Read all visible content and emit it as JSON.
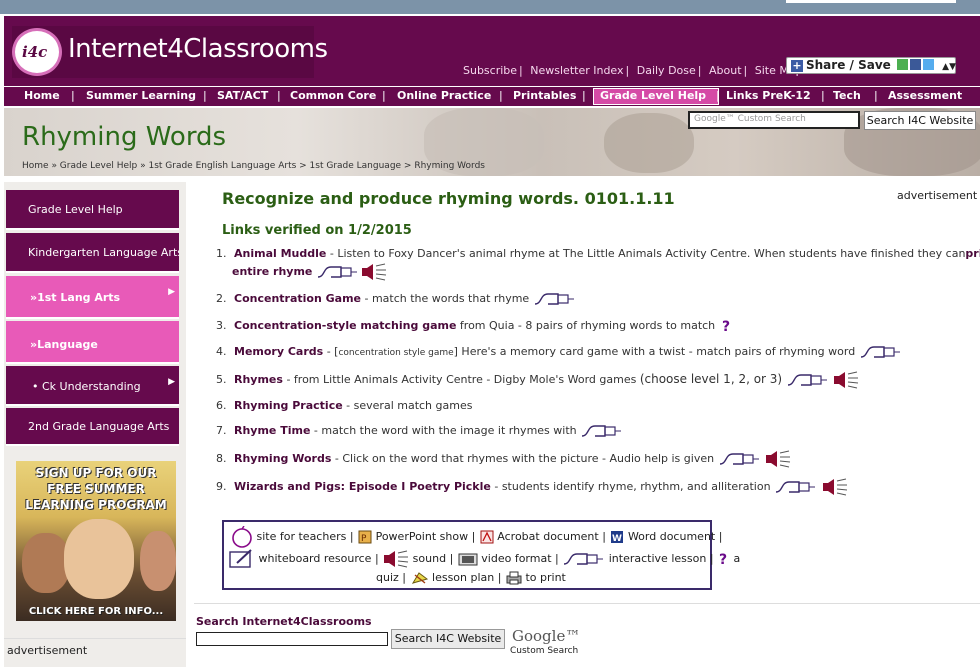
{
  "header": {
    "logo_badge": "i4c",
    "logo_text": "Internet4Classrooms",
    "top_links": [
      "Subscribe",
      "Newsletter Index",
      "Daily Dose",
      "About",
      "Site Map"
    ],
    "share_label": "Share / Save"
  },
  "nav": {
    "items": [
      "Home",
      "Summer Learning",
      "SAT/ACT",
      "Common Core",
      "Online Practice",
      "Printables",
      "Grade Level Help",
      "Links PreK-12",
      "Tech",
      "Assessment"
    ],
    "active": "Grade Level Help"
  },
  "banner": {
    "title": "Rhyming Words",
    "breadcrumb": "Home »  Grade Level Help  »  1st Grade English Language Arts >  1st Grade Language >  Rhyming Words",
    "search_placeholder": "Google™ Custom Search",
    "search_button": "Search I4C Website"
  },
  "sidebar": {
    "items": [
      {
        "label": "Grade Level Help",
        "style": "dark"
      },
      {
        "label": "Kindergarten Language Arts",
        "style": "dark"
      },
      {
        "label": "1st Lang Arts",
        "style": "pink"
      },
      {
        "label": "Language",
        "style": "pink"
      },
      {
        "label": "Ck Understanding",
        "style": "dark"
      },
      {
        "label": "2nd Grade Language Arts",
        "style": "dark"
      }
    ],
    "promo_lines": [
      "SIGN UP FOR OUR",
      "FREE SUMMER",
      "LEARNING PROGRAM"
    ],
    "promo_cta": "CLICK HERE FOR INFO...",
    "advertisement": "advertisement"
  },
  "main": {
    "title": "Recognize and produce rhyming words. 0101.1.11",
    "verified": "Links verified on 1/2/2015",
    "advertisement": "advertisement",
    "items": [
      {
        "num": "1.",
        "title": "Animal Muddle",
        "desc": " - Listen to Foxy Dancer's animal rhyme at The Little Animals Activity Centre. When students have finished they can",
        "desc_bold": "print the",
        "line2_bold": "entire rhyme"
      },
      {
        "num": "2.",
        "title": "Concentration Game",
        "desc": " - match the words that rhyme"
      },
      {
        "num": "3.",
        "title": "Concentration-style matching game",
        "desc": " from Quia - 8 pairs of rhyming words to match"
      },
      {
        "num": "4.",
        "title": "Memory Cards",
        "desc_pre": " - [",
        "bracket": "concentration style game",
        "desc": "] Here's a memory card game with a twist - match pairs of rhyming word"
      },
      {
        "num": "5.",
        "title": "Rhymes",
        "desc": " - from Little Animals Activity Centre - Digby Mole's Word games ",
        "desc_tail": "(choose level 1, 2, or 3)"
      },
      {
        "num": "6.",
        "title": "Rhyming Practice",
        "desc": " - several match games"
      },
      {
        "num": "7.",
        "title": "Rhyme Time",
        "desc": " - match the word with the image it rhymes with"
      },
      {
        "num": "8.",
        "title": "Rhyming Words",
        "desc": " - Click on the word that rhymes with the picture - Audio help is given"
      },
      {
        "num": "9.",
        "title": "Wizards and Pigs: Episode I Poetry Pickle",
        "desc": " - students identify rhyme, rhythm, and alliteration"
      }
    ]
  },
  "legend": {
    "site_for_teachers": "site for teachers",
    "powerpoint": "PowerPoint show",
    "acrobat": "Acrobat document",
    "word": "Word document",
    "whiteboard": "whiteboard resource",
    "sound": "sound",
    "video": "video format",
    "interactive": "interactive lesson",
    "quiz_a": "a",
    "quiz": "quiz",
    "lesson_plan": "lesson plan",
    "to_print": "to print",
    "sep": "|"
  },
  "bottom_search": {
    "label": "Search Internet4Classrooms",
    "button": "Search I4C Website",
    "google": "Google™",
    "google_sub": "Custom Search"
  },
  "colors": {
    "brand": "#660a4d",
    "accent_pink": "#d54aa6",
    "title_green": "#2b5e14"
  }
}
